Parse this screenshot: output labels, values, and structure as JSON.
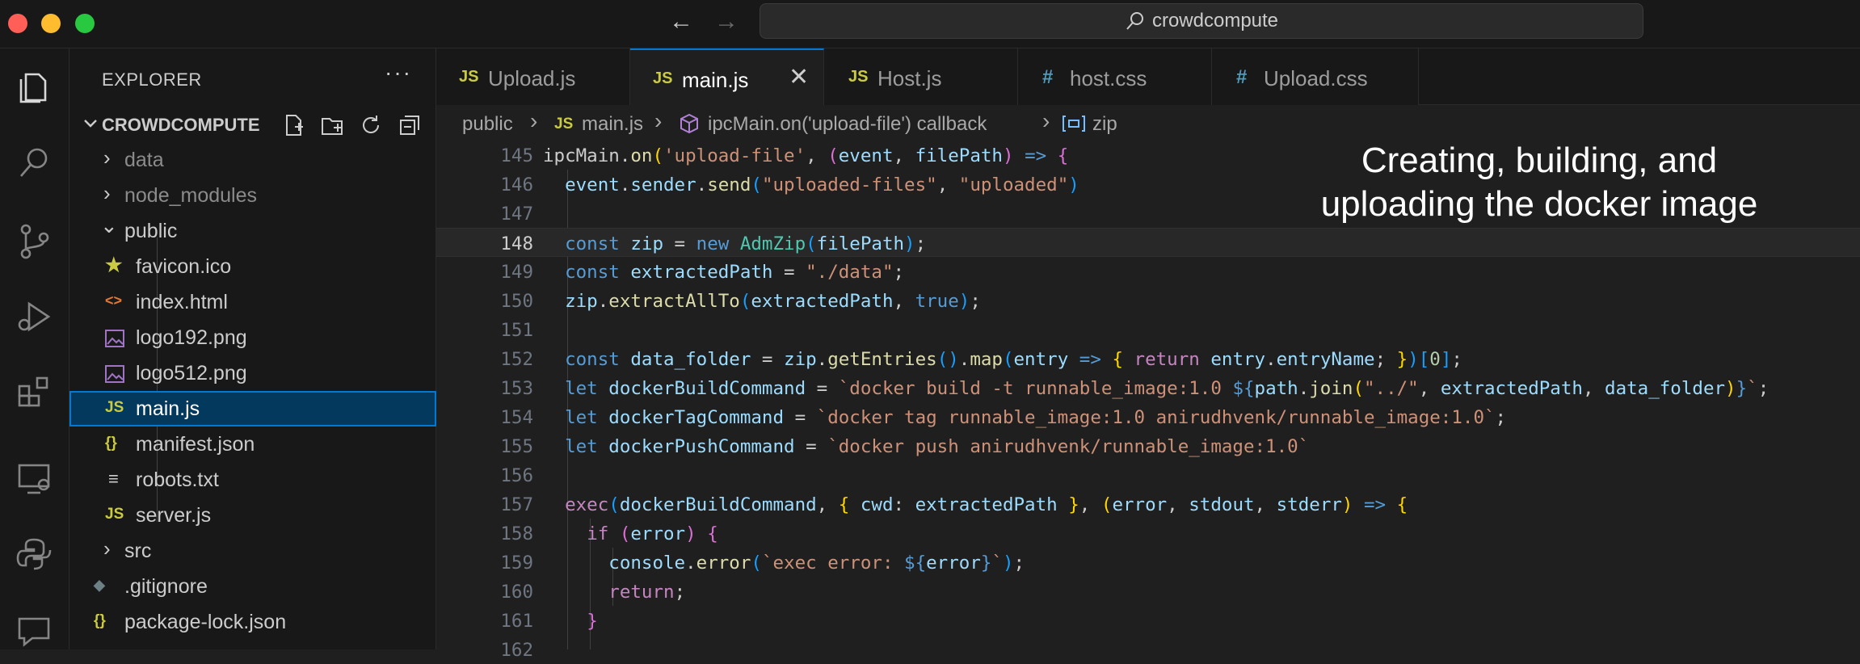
{
  "window": {
    "search_text": "crowdcompute"
  },
  "activity_bar": {
    "items": [
      "explorer-icon",
      "search-icon",
      "source-control-icon",
      "run-debug-icon",
      "extensions-icon",
      "remote-explorer-icon",
      "python-icon",
      "chat-icon"
    ]
  },
  "sidebar": {
    "title": "EXPLORER",
    "more": "···",
    "project": "CROWDCOMPUTE",
    "tree": [
      {
        "label": "data",
        "icon": "›"
      },
      {
        "label": "node_modules",
        "icon": "›"
      },
      {
        "label": "public",
        "icon": "⌄"
      },
      {
        "label": "favicon.ico",
        "icon": "★"
      },
      {
        "label": "index.html",
        "icon": "<>"
      },
      {
        "label": "logo192.png",
        "icon": "image"
      },
      {
        "label": "logo512.png",
        "icon": "image"
      },
      {
        "label": "main.js",
        "icon": "JS"
      },
      {
        "label": "manifest.json",
        "icon": "{}"
      },
      {
        "label": "robots.txt",
        "icon": "≡"
      },
      {
        "label": "server.js",
        "icon": "JS"
      },
      {
        "label": "src",
        "icon": "›"
      },
      {
        "label": ".gitignore",
        "icon": "◆"
      },
      {
        "label": "package-lock.json",
        "icon": "{}"
      }
    ]
  },
  "tabs": [
    {
      "icon": "JS",
      "label": "Upload.js"
    },
    {
      "icon": "JS",
      "label": "main.js",
      "close": "✕"
    },
    {
      "icon": "JS",
      "label": "Host.js"
    },
    {
      "icon": "#",
      "label": "host.css"
    },
    {
      "icon": "#",
      "label": "Upload.css"
    }
  ],
  "breadcrumb": {
    "folder": "public",
    "file_icon": "JS",
    "file": "main.js",
    "symbol": "ipcMain.on('upload-file') callback",
    "variable": "zip",
    "sep": "›"
  },
  "editor": {
    "line_numbers": [
      "145",
      "146",
      "147",
      "148",
      "149",
      "150",
      "151",
      "152",
      "153",
      "154",
      "155",
      "156",
      "157",
      "158",
      "159",
      "160",
      "161",
      "162"
    ],
    "current_line": "148"
  },
  "overlay": {
    "line1": "Creating, building, and",
    "line2": "uploading the docker image"
  },
  "colors": {
    "accent": "#0078d4",
    "js_icon": "#cbcb41",
    "css_icon": "#519aba",
    "json_icon": "#cbcb41",
    "html_icon": "#e37933"
  }
}
